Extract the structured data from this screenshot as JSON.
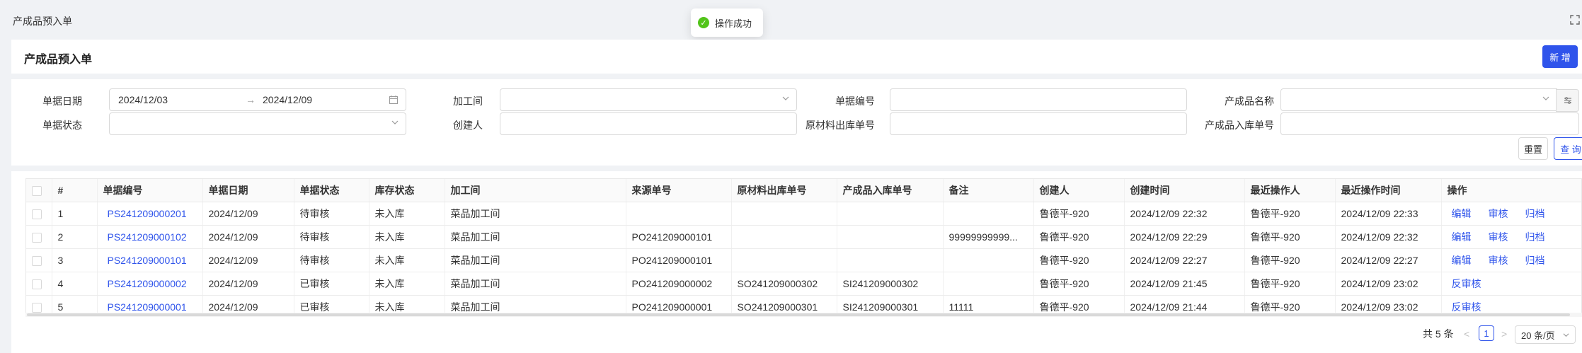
{
  "page": {
    "title": "产成品预入单"
  },
  "toast": {
    "icon": "check-circle-icon",
    "text": "操作成功",
    "color": "#52c41a"
  },
  "header": {
    "title": "产成品预入单",
    "new_label": "新 增"
  },
  "filters": {
    "doc_date_label": "单据日期",
    "date_start": "2024/12/03",
    "date_sep": "→",
    "date_end": "2024/12/09",
    "workshop_label": "加工间",
    "doc_no_label": "单据编号",
    "product_name_label": "产成品名称",
    "doc_status_label": "单据状态",
    "creator_label": "创建人",
    "raw_out_label": "原材料出库单号",
    "product_in_label": "产成品入库单号",
    "reset_label": "重置",
    "query_label": "查 询"
  },
  "table": {
    "columns": [
      "#",
      "单据编号",
      "单据日期",
      "单据状态",
      "库存状态",
      "加工间",
      "来源单号",
      "原材料出库单号",
      "产成品入库单号",
      "备注",
      "创建人",
      "创建时间",
      "最近操作人",
      "最近操作时间",
      "操作"
    ],
    "rows": [
      {
        "idx": "1",
        "no": "PS241209000201",
        "date": "2024/12/09",
        "status": "待审核",
        "stock": "未入库",
        "workshop": "菜品加工间",
        "source": "",
        "raw_out": "",
        "prod_in": "",
        "note": "",
        "creator": "鲁德平-920",
        "created": "2024/12/09 22:32",
        "last_op": "鲁德平-920",
        "last_time": "2024/12/09 22:33",
        "a1": "编辑",
        "a2": "审核",
        "a3": "归档"
      },
      {
        "idx": "2",
        "no": "PS241209000102",
        "date": "2024/12/09",
        "status": "待审核",
        "stock": "未入库",
        "workshop": "菜品加工间",
        "source": "PO241209000101",
        "raw_out": "",
        "prod_in": "",
        "note": "99999999999...",
        "creator": "鲁德平-920",
        "created": "2024/12/09 22:29",
        "last_op": "鲁德平-920",
        "last_time": "2024/12/09 22:32",
        "a1": "编辑",
        "a2": "审核",
        "a3": "归档"
      },
      {
        "idx": "3",
        "no": "PS241209000101",
        "date": "2024/12/09",
        "status": "待审核",
        "stock": "未入库",
        "workshop": "菜品加工间",
        "source": "PO241209000101",
        "raw_out": "",
        "prod_in": "",
        "note": "",
        "creator": "鲁德平-920",
        "created": "2024/12/09 22:27",
        "last_op": "鲁德平-920",
        "last_time": "2024/12/09 22:27",
        "a1": "编辑",
        "a2": "审核",
        "a3": "归档"
      },
      {
        "idx": "4",
        "no": "PS241209000002",
        "date": "2024/12/09",
        "status": "已审核",
        "stock": "未入库",
        "workshop": "菜品加工间",
        "source": "PO241209000002",
        "raw_out": "SO241209000302",
        "prod_in": "SI241209000302",
        "note": "",
        "creator": "鲁德平-920",
        "created": "2024/12/09 21:45",
        "last_op": "鲁德平-920",
        "last_time": "2024/12/09 23:02",
        "a1": "反审核",
        "a2": "",
        "a3": ""
      },
      {
        "idx": "5",
        "no": "PS241209000001",
        "date": "2024/12/09",
        "status": "已审核",
        "stock": "未入库",
        "workshop": "菜品加工间",
        "source": "PO241209000001",
        "raw_out": "SO241209000301",
        "prod_in": "SI241209000301",
        "note": "11111",
        "creator": "鲁德平-920",
        "created": "2024/12/09 21:44",
        "last_op": "鲁德平-920",
        "last_time": "2024/12/09 23:02",
        "a1": "反审核",
        "a2": "",
        "a3": ""
      }
    ]
  },
  "pagination": {
    "total": "共 5 条",
    "prev": "<",
    "current": "1",
    "next": ">",
    "page_size": "20 条/页"
  },
  "colors": {
    "primary": "#2f54eb",
    "success": "#52c41a"
  }
}
